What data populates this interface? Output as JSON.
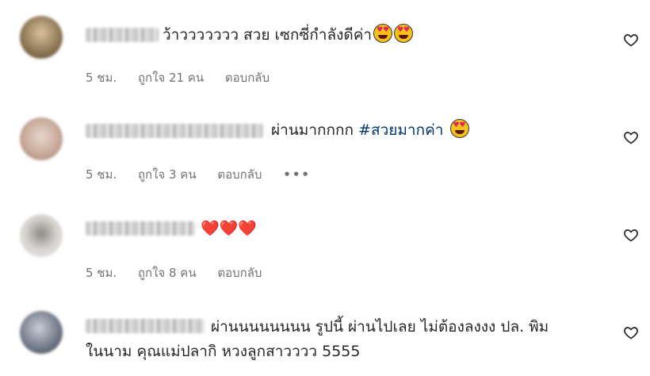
{
  "comments": [
    {
      "text": "ว้าววววววว สวย เซกซี่กำลังดีค่า",
      "emoji": [
        "heart-eyes",
        "heart-eyes"
      ],
      "time": "5 ชม.",
      "likes": "ถูกใจ 21 คน",
      "reply": "ตอบกลับ"
    },
    {
      "text": "ผ่านมากกกก",
      "hashtag": "#สวยมากค่า",
      "emoji": [
        "heart-eyes"
      ],
      "time": "5 ชม.",
      "likes": "ถูกใจ 3 คน",
      "reply": "ตอบกลับ",
      "more": "•••"
    },
    {
      "text": "",
      "emoji_text": "❤️❤️❤️",
      "time": "5 ชม.",
      "likes": "ถูกใจ 8 คน",
      "reply": "ตอบกลับ"
    },
    {
      "text_line1": "ผ่านนนนนนนน รูปนี้ ผ่านไปเลย ไม่ต้องลงงง ปล. พิม",
      "text_line2": "ในนาม คุณแม่ปลากิ หวงลูกสาวววว 5555"
    }
  ],
  "colors": {
    "text": "#262626",
    "meta": "#737373",
    "hashtag": "#00376b",
    "heart": "#e0245e"
  },
  "icons": {
    "like": "heart-outline-icon"
  }
}
